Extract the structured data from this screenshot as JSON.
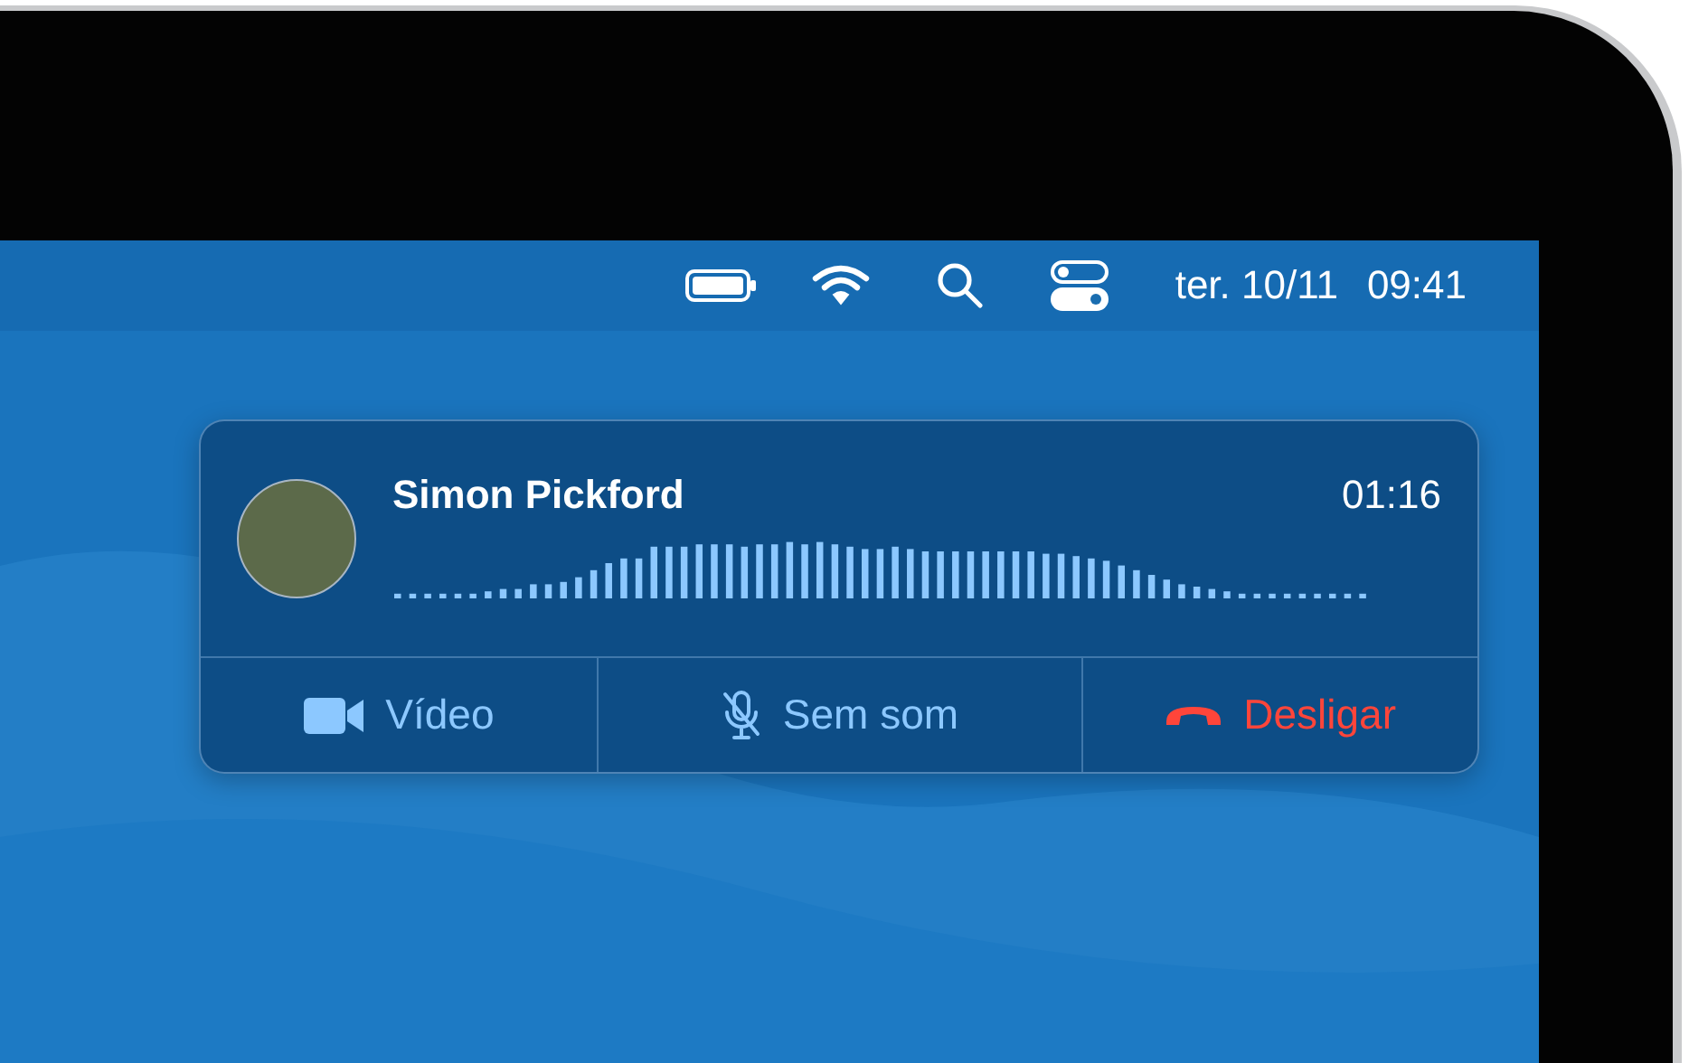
{
  "menu_bar": {
    "date": "ter. 10/11",
    "time": "09:41"
  },
  "call": {
    "caller": "Simon Pickford",
    "duration": "01:16",
    "buttons": [
      {
        "label": "Vídeo",
        "kind": "video"
      },
      {
        "label": "Sem som",
        "kind": "mute"
      },
      {
        "label": "Desligar",
        "kind": "hangup"
      }
    ]
  }
}
